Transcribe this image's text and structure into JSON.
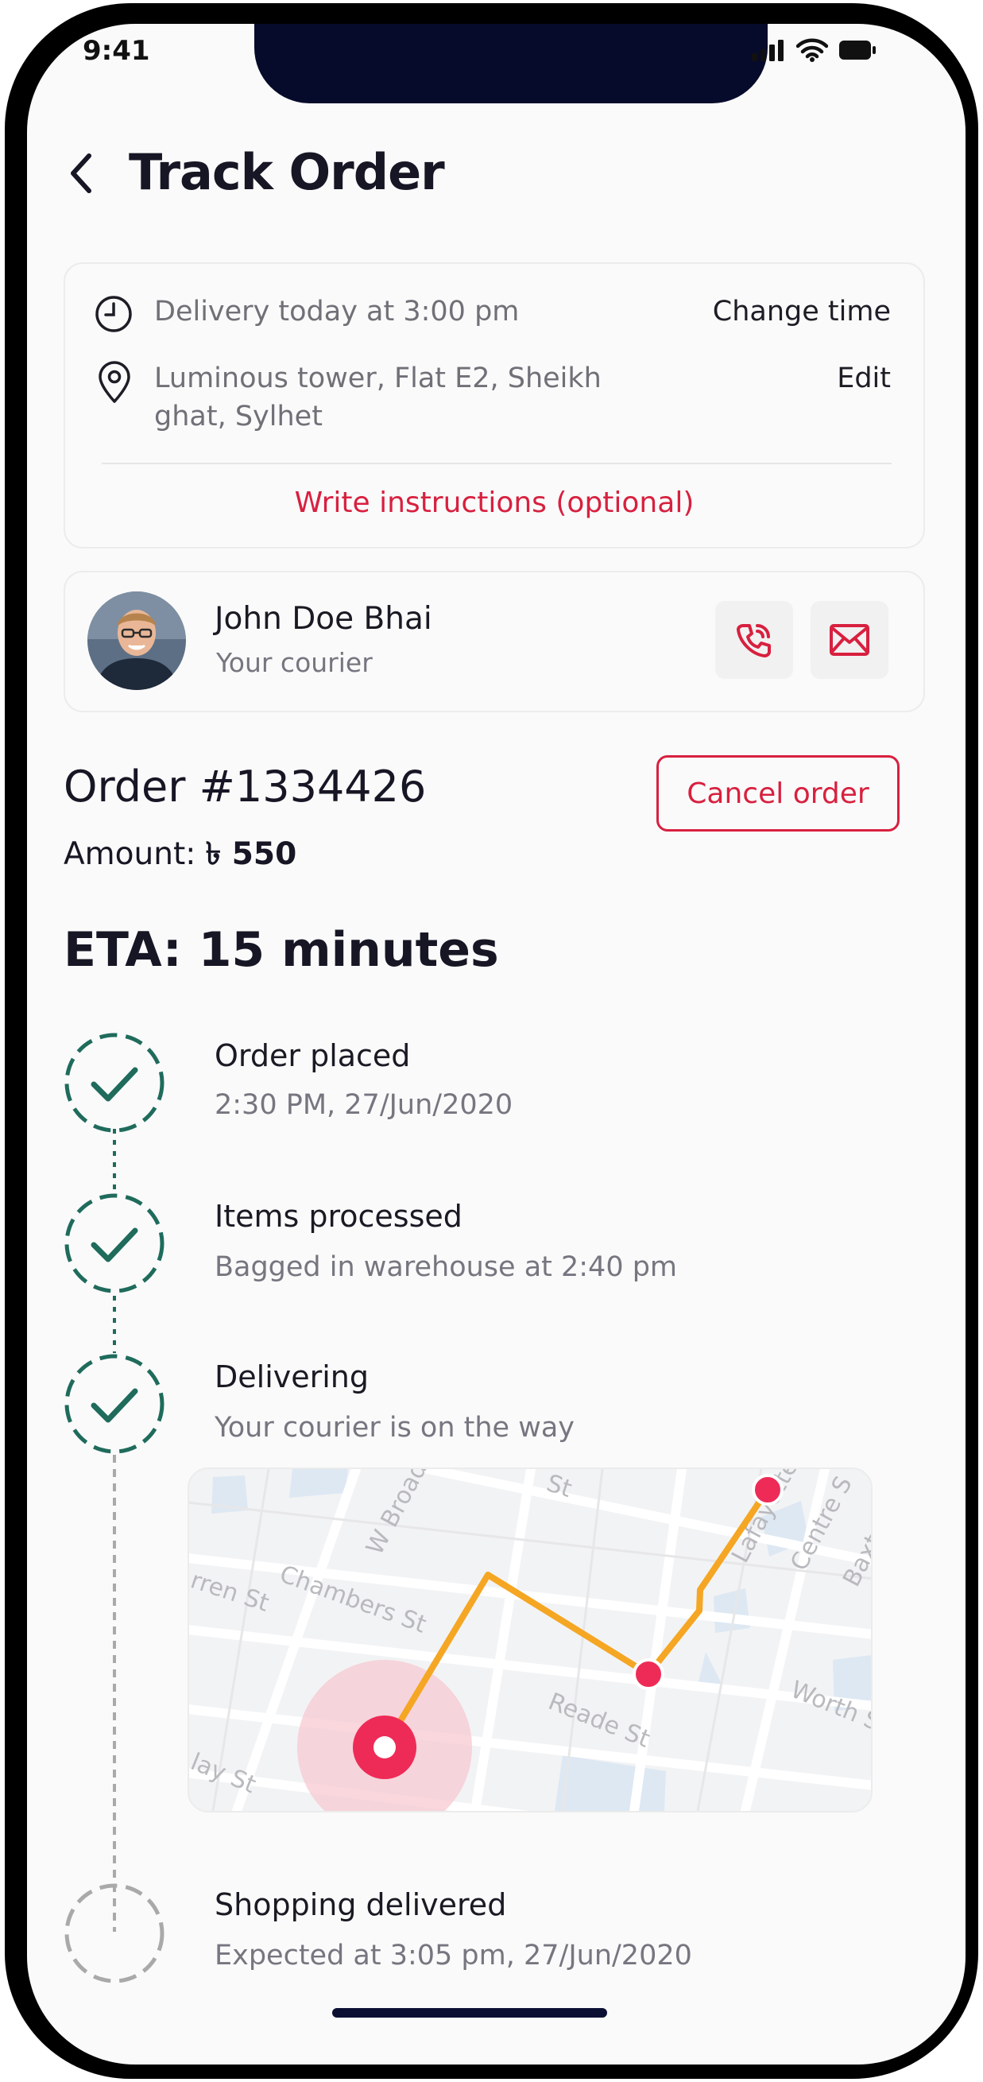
{
  "status_bar": {
    "time": "9:41"
  },
  "header": {
    "title": "Track Order"
  },
  "delivery": {
    "time_text": "Delivery today at 3:00 pm",
    "change_time_label": "Change time",
    "address_line1": "Luminous tower, Flat E2, Sheikh",
    "address_line2": "ghat, Sylhet",
    "edit_label": "Edit",
    "instructions_label": "Write instructions (optional)"
  },
  "courier": {
    "name": "John Doe Bhai",
    "role": "Your courier"
  },
  "order": {
    "number": "Order #1334426",
    "amount_label": "Amount: ",
    "amount_value": "৳ 550",
    "cancel_label": "Cancel order"
  },
  "eta": "ETA: 15 minutes",
  "steps": [
    {
      "title": "Order placed",
      "subtitle": "2:30 PM, 27/Jun/2020",
      "status": "done"
    },
    {
      "title": "Items processed",
      "subtitle": "Bagged in warehouse at 2:40 pm",
      "status": "done"
    },
    {
      "title": "Delivering",
      "subtitle": "Your courier is on the way",
      "status": "done"
    },
    {
      "title": "Shopping delivered",
      "subtitle": "Expected at 3:05 pm, 27/Jun/2020",
      "status": "pending"
    }
  ],
  "map": {
    "streets": [
      "W Broadway",
      "St",
      "Lafayette",
      "Centre S",
      "Baxter",
      "Chambers St",
      "rren St",
      "Reade St",
      "Worth S",
      "lay St"
    ]
  },
  "colors": {
    "accent_red": "#d8203f",
    "step_green": "#1f6b5c",
    "route_orange": "#f5a623",
    "pending_grey": "#a9a9a9"
  }
}
